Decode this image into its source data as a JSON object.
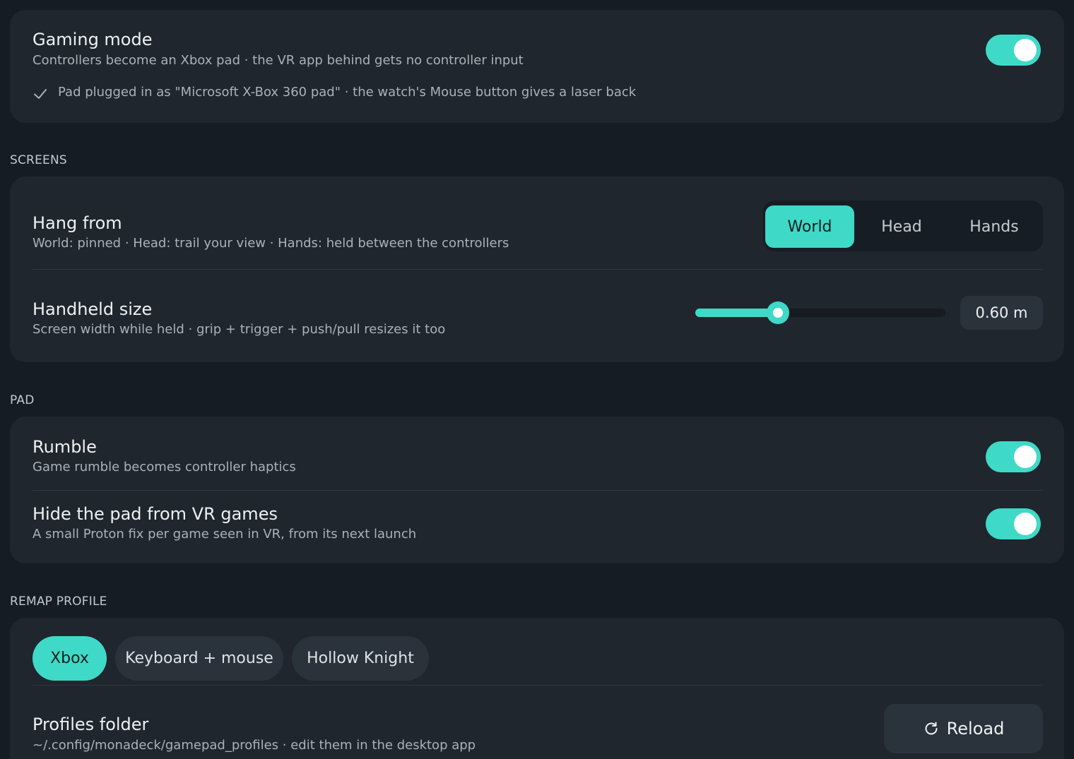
{
  "gaming": {
    "title": "Gaming mode",
    "subtitle": "Controllers become an Xbox pad · the VR app behind gets no controller input",
    "status": "Pad plugged in as \"Microsoft X-Box 360 pad\" · the watch's Mouse button gives a laser back",
    "status_icon": "check-icon",
    "enabled": true
  },
  "screens": {
    "section_label": "SCREENS",
    "hang_from": {
      "title": "Hang from",
      "subtitle": "World: pinned · Head: trail your view · Hands: held between the controllers",
      "options": [
        "World",
        "Head",
        "Hands"
      ],
      "selected": "World"
    },
    "handheld_size": {
      "title": "Handheld size",
      "subtitle": "Screen width while held · grip + trigger + push/pull resizes it too",
      "value_label": "0.60 m",
      "slider_fraction": 0.33
    }
  },
  "pad": {
    "section_label": "PAD",
    "rumble": {
      "title": "Rumble",
      "subtitle": "Game rumble becomes controller haptics",
      "enabled": true
    },
    "hide_pad": {
      "title": "Hide the pad from VR games",
      "subtitle": "A small Proton fix per game seen in VR, from its next launch",
      "enabled": true
    }
  },
  "remap": {
    "section_label": "REMAP PROFILE",
    "profiles": [
      "Xbox",
      "Keyboard + mouse",
      "Hollow Knight"
    ],
    "selected": "Xbox",
    "folder": {
      "title": "Profiles folder",
      "subtitle": "~/.config/monadeck/gamepad_profiles · edit them in the desktop app",
      "reload_label": "Reload",
      "reload_icon": "refresh-icon"
    }
  },
  "colors": {
    "accent": "#3fd9c8",
    "background": "#161c24",
    "card": "#1f262e"
  }
}
